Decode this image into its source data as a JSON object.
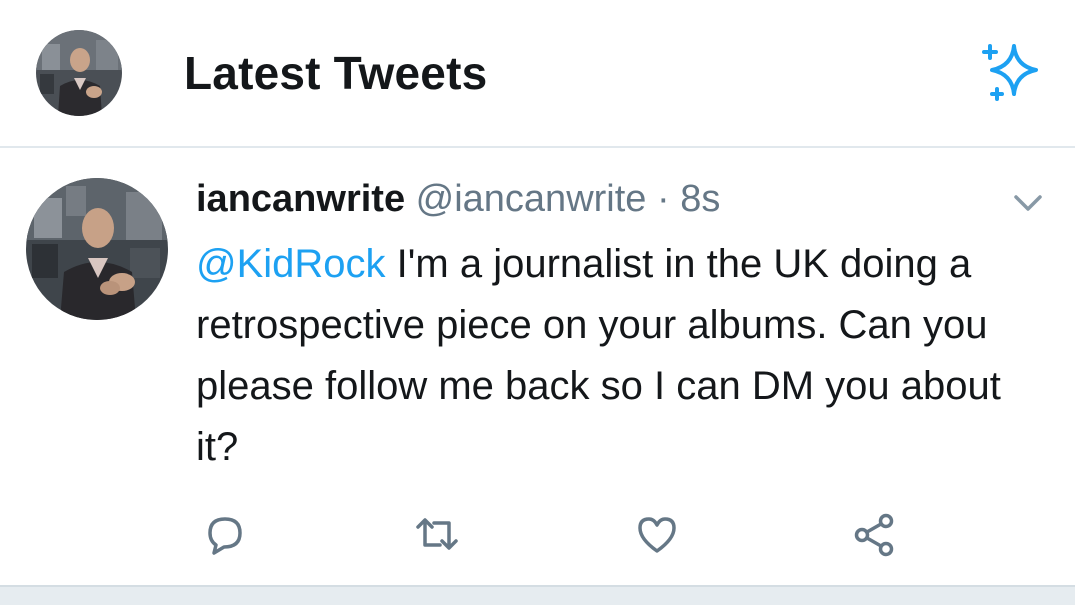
{
  "header": {
    "title": "Latest Tweets",
    "avatar_icon": "profile-avatar-icon",
    "action_icon": "sparkle-icon"
  },
  "tweet": {
    "display_name": "iancanwrite",
    "handle": "@iancanwrite",
    "separator": "·",
    "time": "8s",
    "mention": "@KidRock",
    "body": " I'm a journalist in the UK doing a retrospective piece on your albums. Can you please follow me back so I can DM you about it?",
    "menu_icon": "chevron-down-icon",
    "actions": [
      {
        "name": "reply",
        "icon": "reply-icon"
      },
      {
        "name": "retweet",
        "icon": "retweet-icon"
      },
      {
        "name": "like",
        "icon": "heart-icon"
      },
      {
        "name": "share",
        "icon": "share-icon"
      }
    ]
  },
  "colors": {
    "accent": "#1da1f2",
    "text": "#14171a",
    "muted": "#657786",
    "divider": "#e1e8ed"
  }
}
